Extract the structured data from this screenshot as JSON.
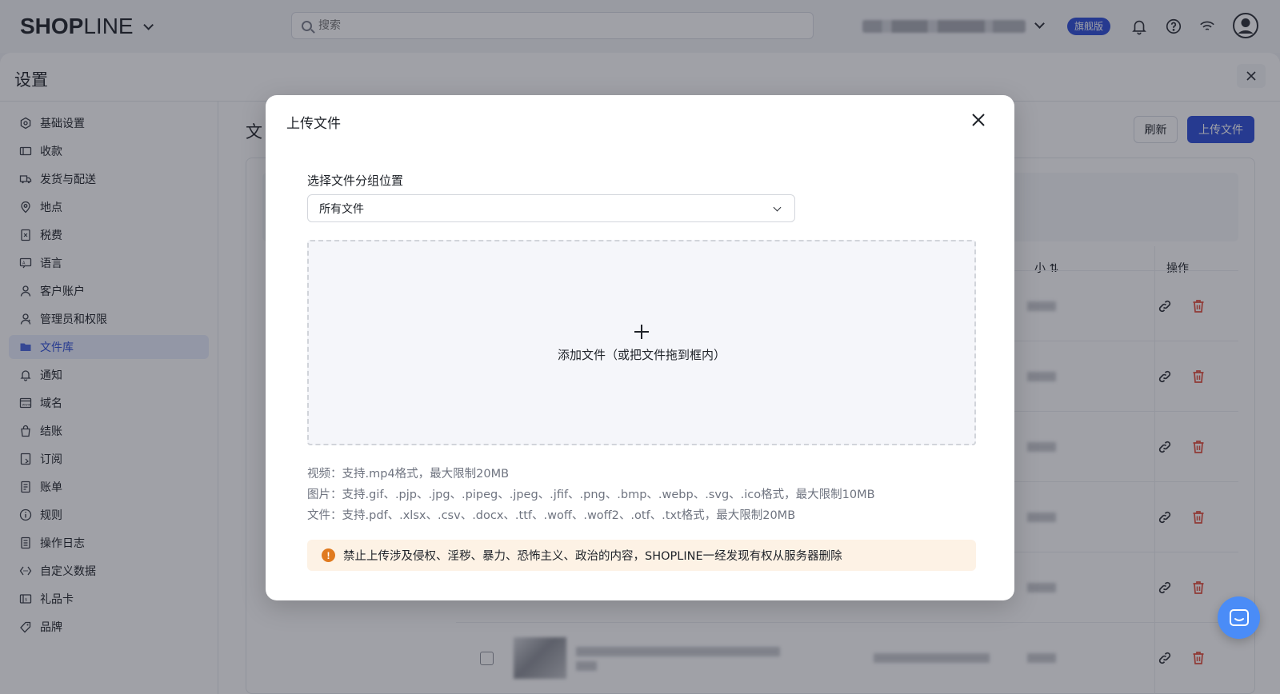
{
  "topbar": {
    "logo_bold": "SHOP",
    "logo_light": "LINE",
    "search_placeholder": "搜索",
    "plan_badge": "旗舰版"
  },
  "settings": {
    "title": "设置"
  },
  "sidebar": {
    "items": [
      {
        "label": "基础设置",
        "icon": "settings-icon"
      },
      {
        "label": "收款",
        "icon": "wallet-icon"
      },
      {
        "label": "发货与配送",
        "icon": "truck-icon"
      },
      {
        "label": "地点",
        "icon": "location-icon"
      },
      {
        "label": "税费",
        "icon": "tax-icon"
      },
      {
        "label": "语言",
        "icon": "language-icon"
      },
      {
        "label": "客户账户",
        "icon": "user-icon"
      },
      {
        "label": "管理员和权限",
        "icon": "admin-icon"
      },
      {
        "label": "文件库",
        "icon": "folder-icon",
        "active": true
      },
      {
        "label": "通知",
        "icon": "bell-icon"
      },
      {
        "label": "域名",
        "icon": "domain-icon"
      },
      {
        "label": "结账",
        "icon": "bag-icon"
      },
      {
        "label": "订阅",
        "icon": "subscribe-icon"
      },
      {
        "label": "账单",
        "icon": "bill-icon"
      },
      {
        "label": "规则",
        "icon": "info-icon"
      },
      {
        "label": "操作日志",
        "icon": "log-icon"
      },
      {
        "label": "自定义数据",
        "icon": "code-icon"
      },
      {
        "label": "礼品卡",
        "icon": "giftcard-icon"
      },
      {
        "label": "品牌",
        "icon": "brand-icon"
      }
    ]
  },
  "content": {
    "title_partial": "文",
    "refresh_label": "刷新",
    "upload_label": "上传文件",
    "th_size": "小 ⇅",
    "th_ops": "操作"
  },
  "modal": {
    "title": "上传文件",
    "field_label": "选择文件分组位置",
    "select_value": "所有文件",
    "dropzone_text": "添加文件（或把文件拖到框内）",
    "hints": [
      "视频：支持.mp4格式，最大限制20MB",
      "图片：支持.gif、.pjp、.jpg、.pipeg、.jpeg、.jfif、.png、.bmp、.webp、.svg、.ico格式，最大限制10MB",
      "文件：支持.pdf、.xlsx、.csv、.docx、.ttf、.woff、.woff2、.otf、.txt格式，最大限制20MB"
    ],
    "warning_icon_glyph": "!",
    "warning": "禁止上传涉及侵权、淫秽、暴力、恐怖主义、政治的内容，SHOPLINE一经发现有权从服务器删除"
  },
  "colors": {
    "primary": "#2d4ed8",
    "warning_bg": "#fdf2e5",
    "warning_icon": "#e07a1f",
    "delete_red": "#e34d3c",
    "chat": "#4a8cf7"
  }
}
